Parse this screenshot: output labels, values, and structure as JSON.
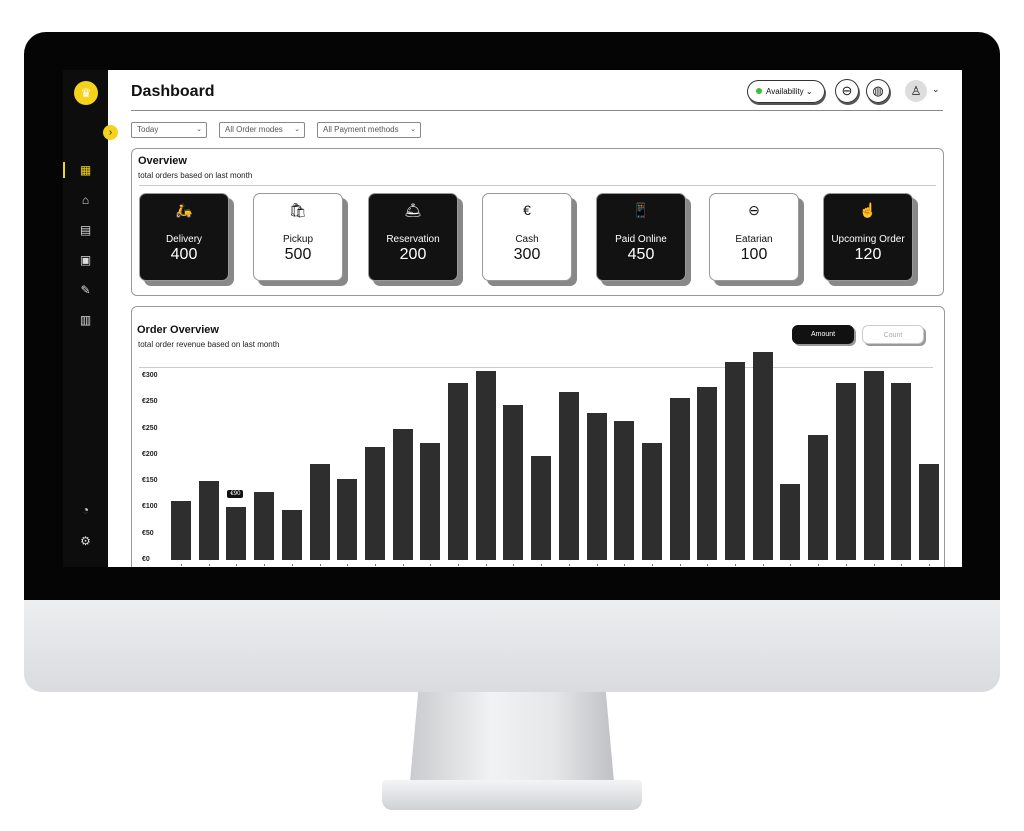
{
  "header": {
    "title": "Dashboard",
    "availability_label": "Availability",
    "availability_color": "#3bbf3b"
  },
  "icons": {
    "logo": "chef-icon",
    "eatarian_button": "eatarian-logo-icon",
    "language_button": "globe-icon",
    "profile": "user-icon"
  },
  "sidebar": {
    "items": [
      {
        "name": "dashboard",
        "icon": "grid-icon",
        "glyph": "▦",
        "active": true
      },
      {
        "name": "orders",
        "icon": "cloche-icon",
        "glyph": "⌂"
      },
      {
        "name": "calendar",
        "icon": "calendar-icon",
        "glyph": "▤"
      },
      {
        "name": "reservations",
        "icon": "calendar-plus-icon",
        "glyph": "▣"
      },
      {
        "name": "marketing",
        "icon": "megaphone-icon",
        "glyph": "✎"
      },
      {
        "name": "pos",
        "icon": "terminal-icon",
        "glyph": "▥"
      }
    ],
    "bottom": [
      {
        "name": "speed",
        "icon": "speedometer-icon",
        "glyph": "◔"
      },
      {
        "name": "settings",
        "icon": "gear-icon",
        "glyph": "⚙"
      }
    ]
  },
  "filters": [
    {
      "value": "Today"
    },
    {
      "value": "All Order modes"
    },
    {
      "value": "All Payment methods"
    }
  ],
  "overview": {
    "title": "Overview",
    "subtitle": "total orders based on last month",
    "cards": [
      {
        "label": "Delivery",
        "value": "400",
        "theme": "dark",
        "icon": "delivery-scooter-icon",
        "glyph": "🛵"
      },
      {
        "label": "Pickup",
        "value": "500",
        "theme": "light",
        "icon": "takeaway-bag-icon",
        "glyph": "🛍"
      },
      {
        "label": "Reservation",
        "value": "200",
        "theme": "dark",
        "icon": "cloche-icon",
        "glyph": "🛎"
      },
      {
        "label": "Cash",
        "value": "300",
        "theme": "light",
        "icon": "euro-coin-icon",
        "glyph": "€"
      },
      {
        "label": "Paid Online",
        "value": "450",
        "theme": "dark",
        "icon": "phone-euro-icon",
        "glyph": "📱"
      },
      {
        "label": "Eatarian",
        "value": "100",
        "theme": "light",
        "icon": "eatarian-logo-icon",
        "glyph": "⊖"
      },
      {
        "label": "Upcoming Order",
        "value": "120",
        "theme": "dark",
        "icon": "tablet-touch-icon",
        "glyph": "☝"
      }
    ]
  },
  "order_overview": {
    "title": "Order Overview",
    "subtitle": "total order revenue based on last month",
    "toggle": [
      {
        "label": "Amount",
        "active": true
      },
      {
        "label": "Count",
        "active": false
      }
    ]
  },
  "chart_data": {
    "type": "bar",
    "ylim": [
      0,
      350
    ],
    "y_ticks": [
      0,
      50,
      100,
      150,
      200,
      250,
      300,
      350
    ],
    "y_tick_labels": [
      "€0",
      "€50",
      "€100",
      "€150",
      "€200",
      "€250",
      "€250",
      "€300"
    ],
    "values": [
      113,
      151,
      100,
      130,
      96,
      183,
      155,
      215,
      249,
      223,
      336,
      360,
      294,
      198,
      319,
      279,
      264,
      223,
      309,
      330,
      377,
      396,
      145,
      238,
      336,
      360,
      336,
      183
    ],
    "bar_color": "#2e2e2e",
    "tooltip": {
      "index": 2,
      "text": "€90"
    },
    "grid": false
  }
}
